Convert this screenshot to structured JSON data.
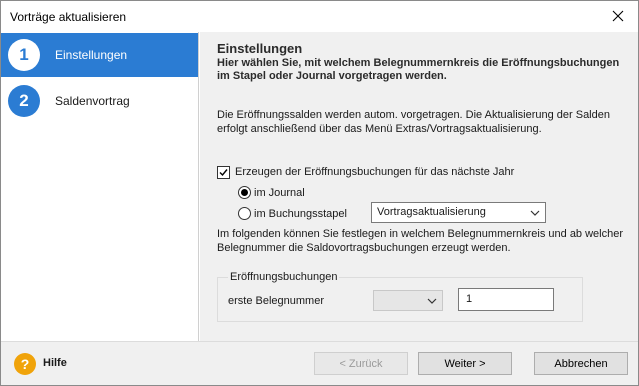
{
  "window": {
    "title": "Vorträge aktualisieren"
  },
  "sidebar": {
    "steps": [
      {
        "number": "1",
        "label": "Einstellungen",
        "active": true
      },
      {
        "number": "2",
        "label": "Saldenvortrag",
        "active": false
      }
    ]
  },
  "content": {
    "heading": "Einstellungen",
    "subheading": "Hier wählen Sie, mit welchem Belegnummernkreis die Eröffnungsbuchungen im Stapel oder Journal vorgetragen werden.",
    "description": "Die Eröffnungssalden werden autom. vorgetragen. Die Aktualisierung der Salden erfolgt anschließend über das Menü Extras/Vortragsaktualisierung.",
    "checkbox_label": "Erzeugen der Eröffnungsbuchungen für das nächste Jahr",
    "checkbox_checked": true,
    "radio_journal_label": "im Journal",
    "radio_journal_selected": true,
    "radio_stapel_label": "im Buchungsstapel",
    "radio_stapel_selected": false,
    "stapel_select_value": "Vortragsaktualisierung",
    "info_text": "Im folgenden können Sie festlegen in welchem Belegnummernkreis und ab welcher Belegnummer die Saldovortragsbuchungen erzeugt werden.",
    "group": {
      "title": "Eröffnungsbuchungen",
      "field_label": "erste Belegnummer",
      "range_select_value": "",
      "number_value": "1"
    }
  },
  "footer": {
    "help_label": "Hilfe",
    "help_icon": "question-icon",
    "back_label": "< Zurück",
    "next_label": "Weiter >",
    "cancel_label": "Abbrechen"
  },
  "colors": {
    "accent": "#2b7cd3",
    "help": "#f0a30a",
    "panel": "#f0f0f0"
  }
}
